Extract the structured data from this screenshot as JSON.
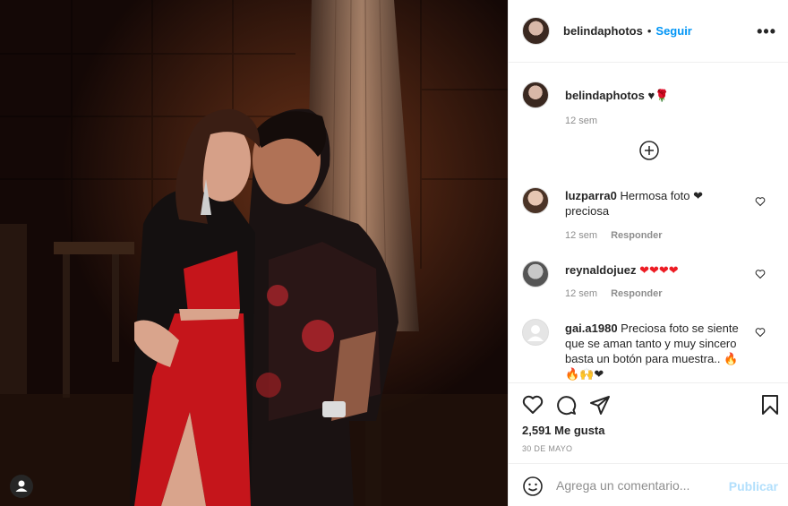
{
  "header": {
    "username": "belindaphotos",
    "separator": "•",
    "follow_label": "Seguir",
    "more_label": "•••"
  },
  "caption": {
    "username": "belindaphotos",
    "text": "♥🌹",
    "time": "12 sem"
  },
  "comments": [
    {
      "username": "luzparra0",
      "text": "Hermosa foto ❤ preciosa",
      "time": "12 sem",
      "reply": "Responder"
    },
    {
      "username": "reynaldojuez",
      "text": "❤❤❤❤",
      "time": "12 sem",
      "reply": "Responder"
    },
    {
      "username": "gai.a1980",
      "text": "Preciosa foto se siente que se aman tanto y muy sincero basta un botón para muestra.. 🔥🔥🙌❤"
    }
  ],
  "likes": "2,591 Me gusta",
  "date": "30 DE MAYO",
  "add_comment": {
    "placeholder": "Agrega un comentario...",
    "publish": "Publicar"
  },
  "colors": {
    "accent": "#0095f6",
    "heart_red": "#ed1c24",
    "muted": "#8e8e8e"
  },
  "icons": [
    "heart-icon",
    "comment-icon",
    "share-icon",
    "bookmark-icon",
    "plus-circle-icon",
    "emoji-icon",
    "user-tag-icon"
  ]
}
